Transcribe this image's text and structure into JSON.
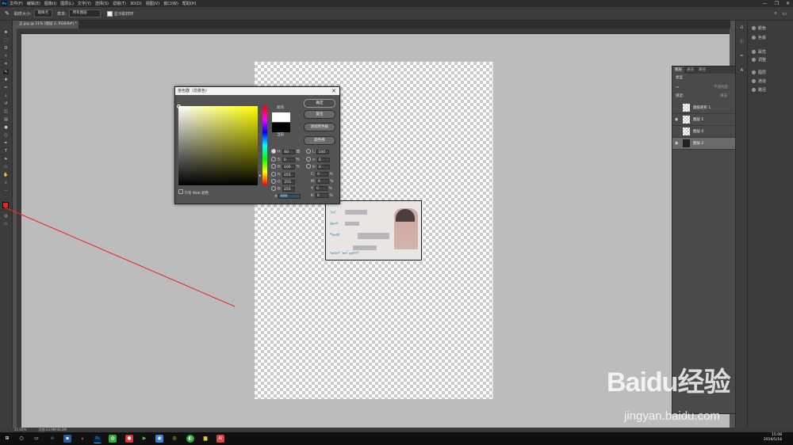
{
  "menubar": {
    "logo": "Ps",
    "items": [
      "文件(F)",
      "编辑(E)",
      "图像(I)",
      "图层(L)",
      "文字(Y)",
      "选择(S)",
      "滤镜(T)",
      "3D(D)",
      "视图(V)",
      "窗口(W)",
      "帮助(H)"
    ],
    "window_controls": [
      "—",
      "❐",
      "✕"
    ]
  },
  "options": {
    "size_label": "取样大小:",
    "size_value": "取样点",
    "sample_label": "样本:",
    "sample_value": "所有图层",
    "ring_label": "显示取样环"
  },
  "document": {
    "tab_title": "正.jpg @ 21% (图层 2, RGB/8#) *",
    "close": "×"
  },
  "color_picker": {
    "title": "拾色器（前景色）",
    "close": "✕",
    "new_label": "新的",
    "current_label": "当前",
    "buttons": {
      "ok": "确定",
      "reset": "复位",
      "add_swatch": "添加到色板",
      "libraries": "颜色库"
    },
    "fields": {
      "H": "60",
      "H_unit": "度",
      "S": "0",
      "S_unit": "%",
      "B": "100",
      "B_unit": "%",
      "R": "255",
      "G": "255",
      "Bl": "255",
      "L": "100",
      "a": "0",
      "b": "0",
      "C": "0",
      "M": "0",
      "Y": "0",
      "K": "0",
      "hex_label": "#",
      "hex": "ffffff"
    },
    "web_only_label": "只有 Web 颜色"
  },
  "layers_panel": {
    "tabs": [
      "图层",
      "通道",
      "路径"
    ],
    "kind_label": "类型",
    "opacity_label": "不透明度:",
    "lock_label": "锁定:",
    "fill_label": "填充:",
    "layers": [
      {
        "name": "圆角矩形 1",
        "visible": false,
        "selected": false
      },
      {
        "name": "图层 1",
        "visible": true,
        "selected": false
      },
      {
        "name": "图层 0",
        "visible": false,
        "selected": false
      },
      {
        "name": "图层 2",
        "visible": true,
        "selected": true
      }
    ]
  },
  "right_panel": {
    "items": [
      "颜色",
      "色板",
      "属性",
      "调整",
      "图层",
      "通道",
      "路径"
    ]
  },
  "status": {
    "zoom": "21.05%",
    "doc_info": "文档:24.9M/46.0M"
  },
  "taskbar": {
    "time": "15:08",
    "date": "2019/5/18"
  },
  "watermark": {
    "brand": "Baidu经验",
    "url": "jingyan.baidu.com"
  },
  "colors": {
    "accent_red": "#e52727",
    "panel_bg": "#3c3c3c",
    "canvas_bg": "#bcbcbc"
  }
}
